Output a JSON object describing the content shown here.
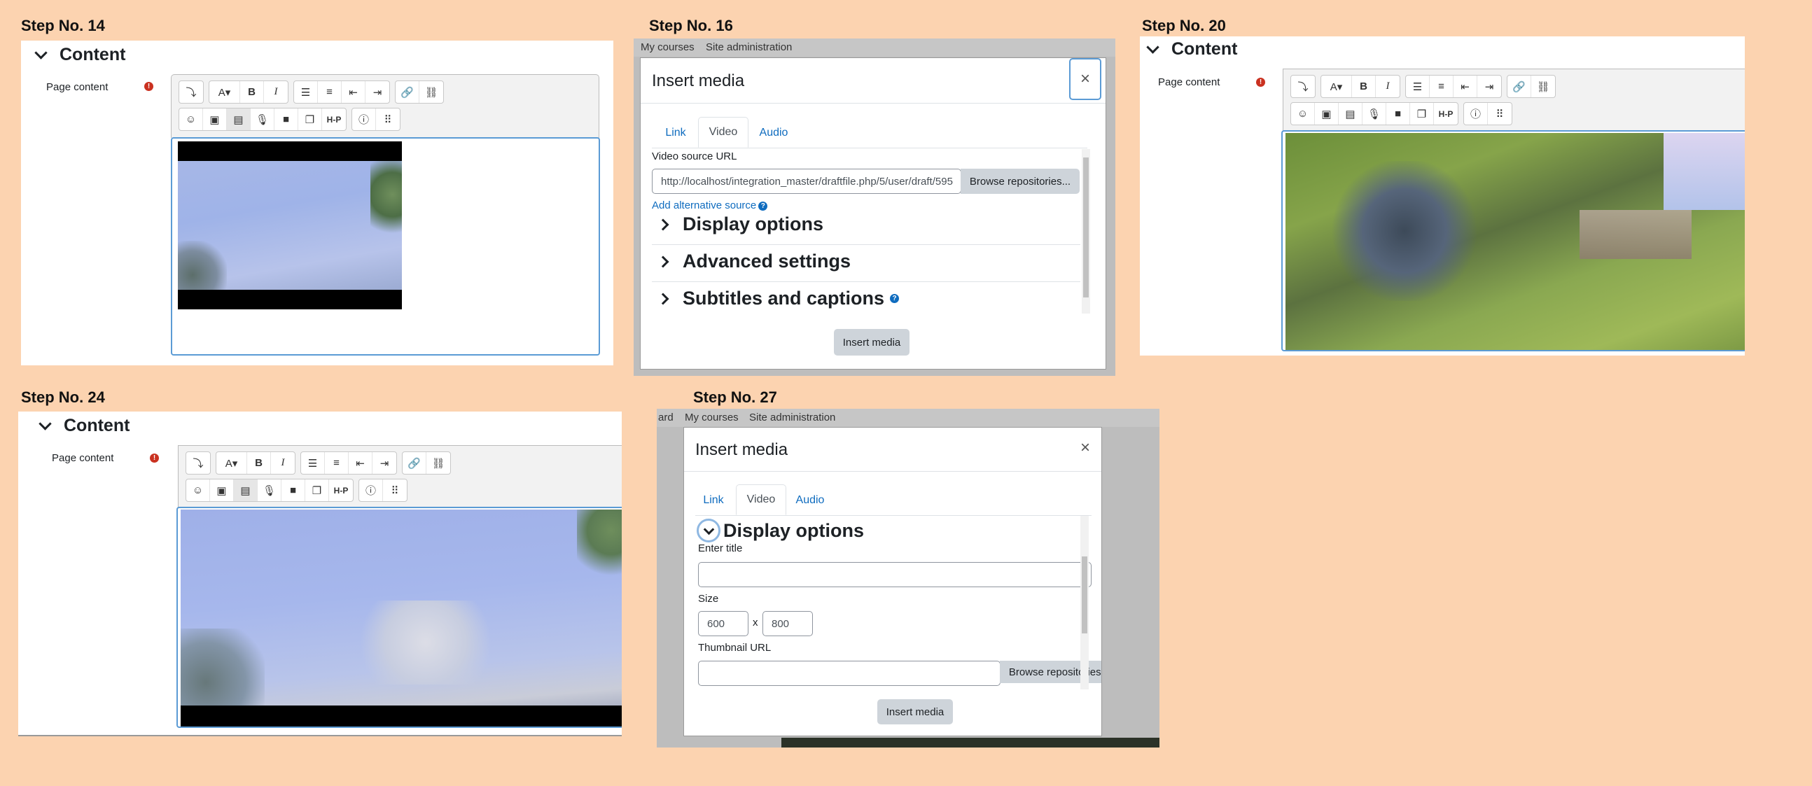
{
  "steps": [
    {
      "label": "Step No. 14"
    },
    {
      "label": "Step No. 16"
    },
    {
      "label": "Step No. 20"
    },
    {
      "label": "Step No. 24"
    },
    {
      "label": "Step No. 27"
    }
  ],
  "editor": {
    "section_title": "Content",
    "field_label": "Page content",
    "required_icon": "exclamation-circle-icon",
    "toolbar_row1_icons": [
      "collapse-icon",
      "font-style-icon",
      "bold-icon",
      "italic-icon",
      "unordered-list-icon",
      "ordered-list-icon",
      "outdent-icon",
      "indent-icon",
      "link-icon",
      "unlink-icon"
    ],
    "toolbar_row2_icons": [
      "emoji-icon",
      "image-icon",
      "media-icon",
      "record-audio-icon",
      "record-video-icon",
      "manage-files-icon",
      "h5p-icon",
      "accessibility-checker-icon",
      "screenreader-helper-icon"
    ],
    "bold_glyph": "B",
    "italic_glyph": "I",
    "h5p_glyph": "H-P"
  },
  "nav": {
    "my_courses": "My courses",
    "site_admin": "Site administration",
    "dashboard_partial": "ard"
  },
  "modal": {
    "title": "Insert media",
    "close_glyph": "×",
    "tabs": [
      "Link",
      "Video",
      "Audio"
    ],
    "video_source_label": "Video source URL",
    "video_source_value": "http://localhost/integration_master/draftfile.php/5/user/draft/595",
    "browse_label": "Browse repositories...",
    "add_alt_source": "Add alternative source",
    "sections": [
      "Display options",
      "Advanced settings",
      "Subtitles and captions"
    ],
    "insert_label": "Insert media",
    "enter_title_label": "Enter title",
    "enter_title_value": "",
    "size_label": "Size",
    "size_width": "600",
    "size_x": "x",
    "size_height": "800",
    "thumbnail_label": "Thumbnail URL",
    "thumbnail_value": ""
  },
  "colors": {
    "background": "#fcd3b0",
    "link": "#0f6cbf",
    "focus": "#5b9bd5",
    "required": "#ca3120"
  }
}
